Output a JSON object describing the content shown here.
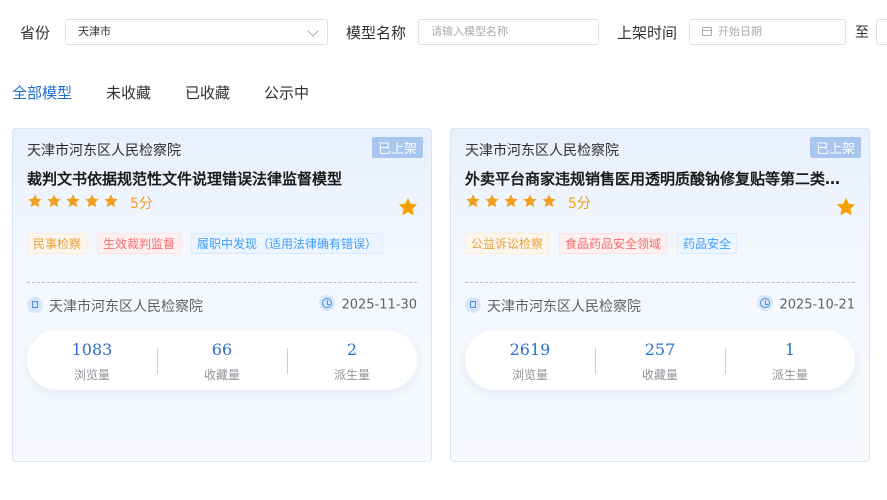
{
  "filters": {
    "province_label": "省份",
    "province_value": "天津市",
    "model_name_label": "模型名称",
    "model_name_placeholder": "请输入模型名称",
    "listed_time_label": "上架时间",
    "start_date_placeholder": "开始日期",
    "to_label": "至"
  },
  "tabs": [
    {
      "label": "全部模型",
      "active": true
    },
    {
      "label": "未收藏",
      "active": false
    },
    {
      "label": "已收藏",
      "active": false
    },
    {
      "label": "公示中",
      "active": false
    }
  ],
  "colors": {
    "accent": "#1f6fd1",
    "star": "#f0a020"
  },
  "cards": [
    {
      "org": "天津市河东区人民检察院",
      "badge": "已上架",
      "title": "裁判文书依据规范性文件说理错误法律监督模型",
      "rating": 5,
      "score": "5分",
      "tags": [
        "民事检察",
        "生效裁判监督",
        "履职中发现（适用法律确有错误）"
      ],
      "meta_org": "天津市河东区人民检察院",
      "date": "2025-11-30",
      "stats": [
        {
          "value": "1083",
          "label": "浏览量"
        },
        {
          "value": "66",
          "label": "收藏量"
        },
        {
          "value": "2",
          "label": "派生量"
        }
      ]
    },
    {
      "org": "天津市河东区人民检察院",
      "badge": "已上架",
      "title": "外卖平台商家违规销售医用透明质酸钠修复贴等第二类医疗器械",
      "rating": 5,
      "score": "5分",
      "tags": [
        "公益诉讼检察",
        "食品药品安全领域",
        "药品安全"
      ],
      "meta_org": "天津市河东区人民检察院",
      "date": "2025-10-21",
      "stats": [
        {
          "value": "2619",
          "label": "浏览量"
        },
        {
          "value": "257",
          "label": "收藏量"
        },
        {
          "value": "1",
          "label": "派生量"
        }
      ]
    }
  ]
}
